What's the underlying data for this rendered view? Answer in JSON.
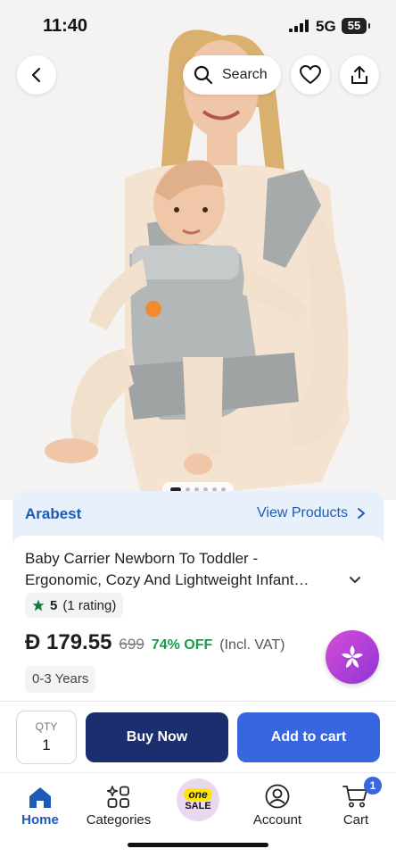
{
  "status_bar": {
    "time": "11:40",
    "network": "5G",
    "battery": "55"
  },
  "top_nav": {
    "search_label": "Search"
  },
  "seller": {
    "name": "Arabest",
    "view_products": "View Products"
  },
  "product": {
    "title": "Baby Carrier Newborn To Toddler - Ergonomic, Cozy And Lightweight Infant…",
    "rating_score": "5",
    "rating_count": "(1 rating)",
    "price": "179.55",
    "currency_symbol": "Ð",
    "old_price": "699",
    "discount": "74% OFF",
    "vat_note": "(Incl. VAT)",
    "variant": "0-3 Years",
    "image_count": 6,
    "active_image": 1
  },
  "action_bar": {
    "qty_label": "QTY",
    "qty_value": "1",
    "buy_now": "Buy Now",
    "add_to_cart": "Add to cart"
  },
  "tabs": [
    {
      "label": "Home",
      "icon": "home-icon",
      "active": true
    },
    {
      "label": "Categories",
      "icon": "categories-icon",
      "active": false
    },
    {
      "label": "SALE",
      "icon": "one-sale-icon",
      "badge_text": "one",
      "active": false
    },
    {
      "label": "Account",
      "icon": "account-icon",
      "active": false
    },
    {
      "label": "Cart",
      "icon": "cart-icon",
      "badge": "1",
      "active": false
    }
  ],
  "colors": {
    "brand_blue": "#1d5bb7",
    "buy_now": "#1b2f6e",
    "add_to_cart": "#3866df",
    "discount_green": "#1a9c4a",
    "rating_star": "#1a7a3a"
  }
}
